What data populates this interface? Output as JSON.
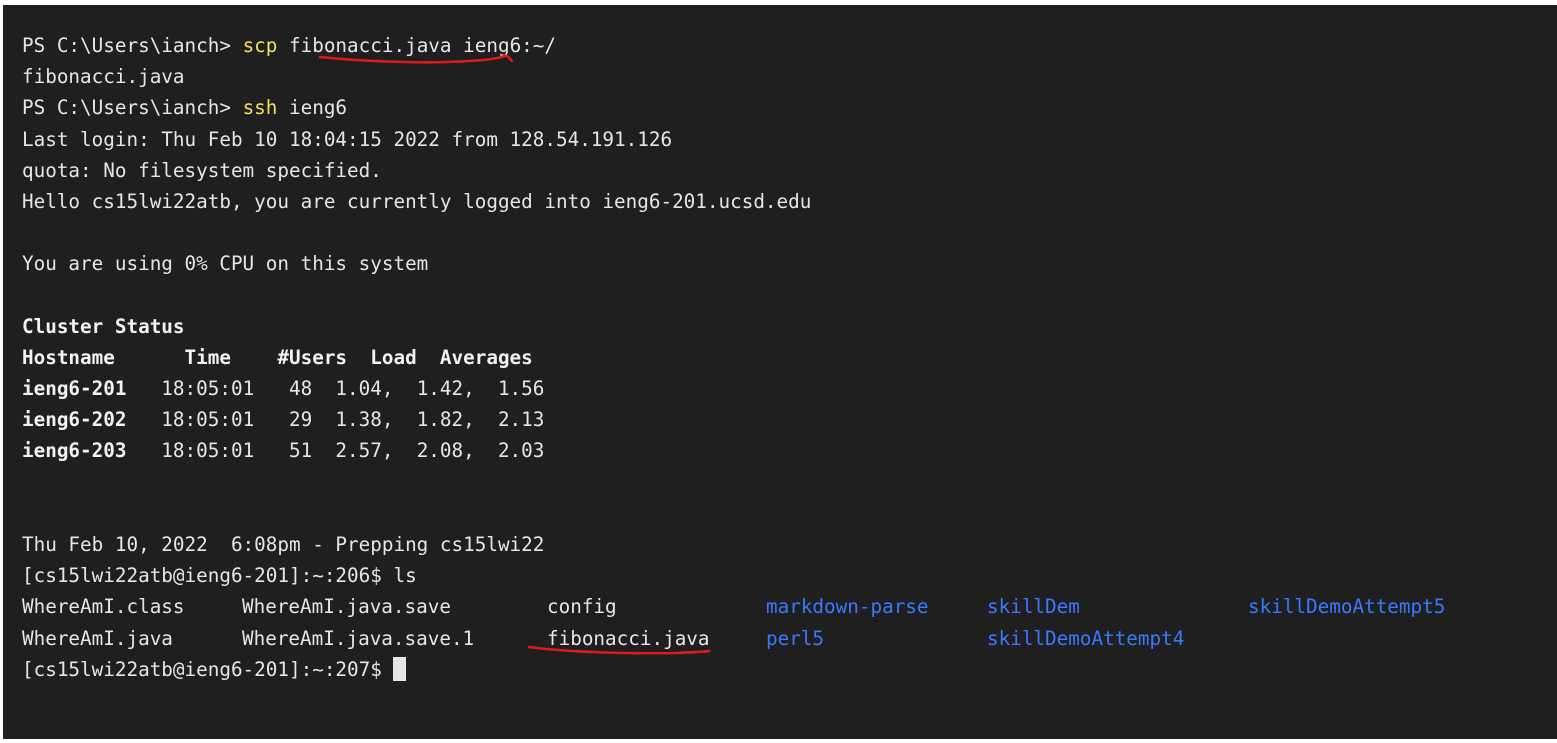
{
  "session": {
    "line1": {
      "prompt": "PS C:\\Users\\ianch> ",
      "cmd": "scp",
      "sp": " ",
      "arg": "fibonacci.java",
      "rest": " ieng6:~/"
    },
    "line2": "fibonacci.java",
    "line3": {
      "prompt": "PS C:\\Users\\ianch> ",
      "cmd": "ssh",
      "rest": " ieng6"
    },
    "last_login": "Last login: Thu Feb 10 18:04:15 2022 from 128.54.191.126",
    "quota": "quota: No filesystem specified.",
    "hello": "Hello cs15lwi22atb, you are currently logged into ieng6-201.ucsd.edu",
    "cpu": "You are using 0% CPU on this system"
  },
  "cluster": {
    "title": "Cluster Status",
    "header": "Hostname      Time    #Users  Load  Averages",
    "rows": [
      {
        "host": "ieng6-201",
        "stats": "   18:05:01   48  1.04,  1.42,  1.56"
      },
      {
        "host": "ieng6-202",
        "stats": "   18:05:01   29  1.38,  1.82,  2.13"
      },
      {
        "host": "ieng6-203",
        "stats": "   18:05:01   51  2.57,  2.08,  2.03"
      }
    ]
  },
  "motd": "Thu Feb 10, 2022  6:08pm - Prepping cs15lwi22",
  "ls_prompt": "[cs15lwi22atb@ieng6-201]:~:206$ ls",
  "ls_output": {
    "row1": {
      "c1": "WhereAmI.class",
      "c2": "WhereAmI.java.save",
      "c3": "config",
      "c4": "markdown-parse",
      "c5": "skillDem",
      "c6": "skillDemoAttempt5"
    },
    "row2": {
      "c1": "WhereAmI.java",
      "c2": "WhereAmI.java.save.1",
      "c3": "fibonacci.java",
      "c4": "perl5",
      "c5": "skillDemoAttempt4"
    }
  },
  "final_prompt": "[cs15lwi22atb@ieng6-201]:~:207$ ",
  "colors": {
    "background": "#1f1f1f",
    "text": "#e6e6e6",
    "command": "#f1e05a",
    "directory": "#3b78ff",
    "annotation": "#e0191e"
  }
}
